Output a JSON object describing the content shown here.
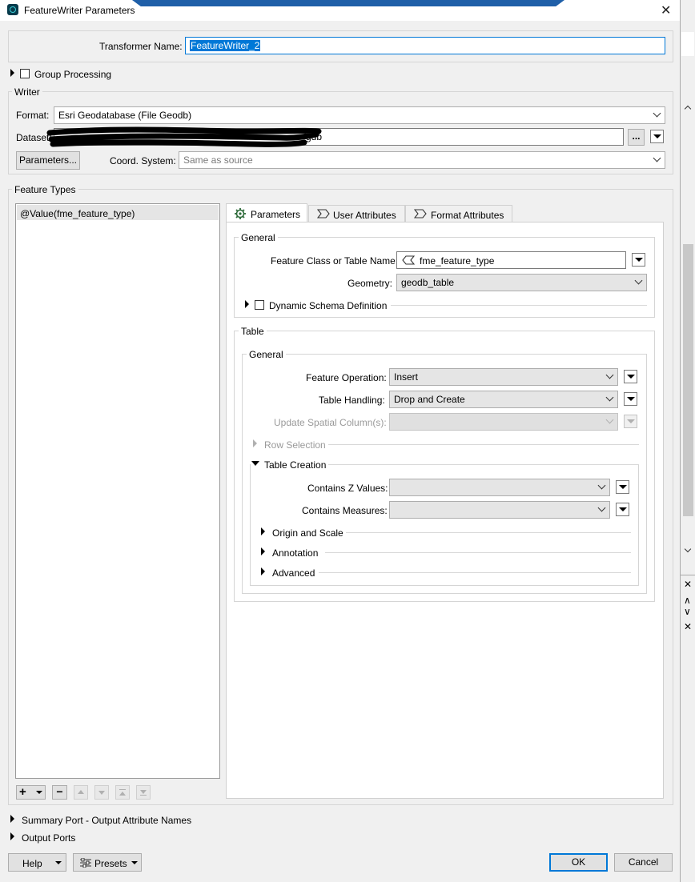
{
  "window": {
    "title": "FeatureWriter Parameters",
    "close_glyph": "✕"
  },
  "transformer": {
    "label": "Transformer Name:",
    "value": "FeatureWriter_2"
  },
  "group_processing": {
    "label": "Group Processing"
  },
  "writer": {
    "legend": "Writer",
    "format_label": "Format:",
    "format_value": "Esri Geodatabase (File Geodb)",
    "dataset_label": "Dataset:",
    "dataset_tail": "gdb",
    "ellipsis_label": "...",
    "parameters_button": "Parameters...",
    "coord_label": "Coord. System:",
    "coord_placeholder": "Same as source"
  },
  "feature_types": {
    "legend": "Feature Types",
    "items": [
      "@Value(fme_feature_type)"
    ]
  },
  "tabs": [
    {
      "label": "Parameters",
      "icon": "gear-icon"
    },
    {
      "label": "User Attributes",
      "icon": "sigma-icon"
    },
    {
      "label": "Format Attributes",
      "icon": "sigma-icon"
    }
  ],
  "general": {
    "legend": "General",
    "feature_class_label": "Feature Class or Table Name:",
    "feature_class_value": "fme_feature_type",
    "geometry_label": "Geometry:",
    "geometry_value": "geodb_table",
    "dynamic_schema_label": "Dynamic Schema Definition"
  },
  "table": {
    "legend": "Table",
    "general_legend": "General",
    "feature_operation_label": "Feature Operation:",
    "feature_operation_value": "Insert",
    "table_handling_label": "Table Handling:",
    "table_handling_value": "Drop and Create",
    "update_spatial_label": "Update Spatial Column(s):",
    "update_spatial_value": "",
    "row_selection_label": "Row Selection",
    "table_creation_label": "Table Creation",
    "contains_z_label": "Contains Z Values:",
    "contains_z_value": "",
    "contains_measures_label": "Contains Measures:",
    "contains_measures_value": "",
    "origin_scale_label": "Origin and Scale",
    "annotation_label": "Annotation",
    "advanced_label": "Advanced"
  },
  "list_buttons": {
    "add": "+",
    "remove": "−"
  },
  "summary_port_label": "Summary Port - Output Attribute Names",
  "output_ports_label": "Output Ports",
  "footer": {
    "help": "Help",
    "presets": "Presets",
    "ok": "OK",
    "cancel": "Cancel"
  },
  "right_strip": {
    "close1": "✕",
    "up": "∧",
    "down": "∨",
    "close2": "✕"
  }
}
